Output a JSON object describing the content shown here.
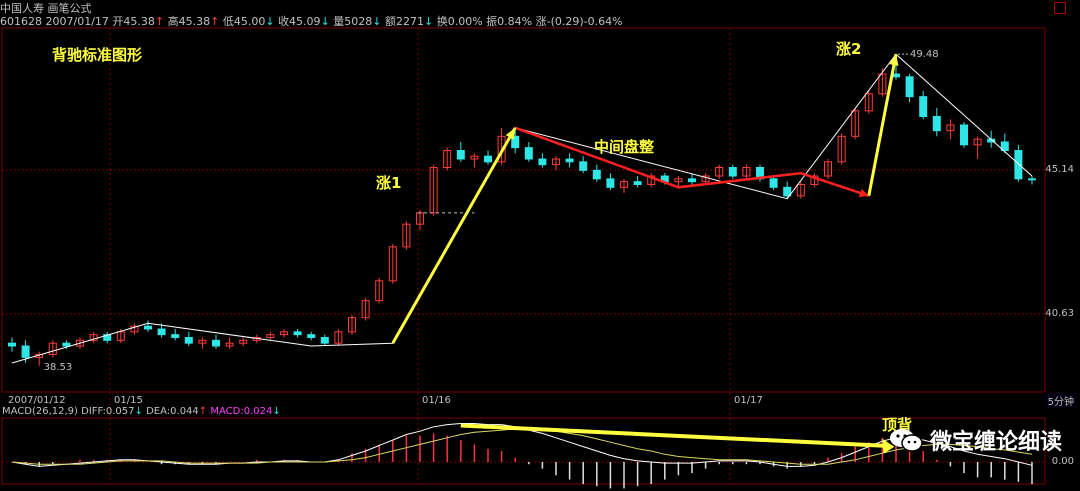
{
  "header": {
    "stock_name": "中国人寿",
    "tool": "画笔公式",
    "code": "601628",
    "date": "2007/01/17",
    "open_label": "开45.38",
    "high_label": "高45.38",
    "low_label": "低45.00",
    "close_label": "收45.09",
    "volume_label": "量5028",
    "amount_label": "额2271",
    "turnover_label": "换0.00%",
    "amplitude_label": "振0.84%",
    "change_label": "涨-(0.29)-0.64%"
  },
  "colors": {
    "up": "#ff3b3b",
    "down": "#2ee6e6",
    "pen_white": "#ffffff",
    "pen_red": "#ff2020",
    "annotation": "#ffff40",
    "grid": "#7a0000"
  },
  "annotations": {
    "title": "背驰标准图形",
    "rise1": "涨1",
    "consolidation": "中间盘整",
    "rise2": "涨2",
    "top_divergence": "顶背"
  },
  "price_labels": {
    "high_point": "49.48",
    "low_point": "38.53",
    "right_45": "45.14",
    "right_40": "40.63"
  },
  "x_labels": [
    "2007/01/12",
    "01/15",
    "01/16",
    "01/17"
  ],
  "timeframe": "5分钟",
  "macd_legend": {
    "name": "MACD(26,12,9)",
    "diff": "DIFF:0.057",
    "dea": "DEA:0.044",
    "macd": "MACD:0.024"
  },
  "macd_axis_label": "0.00",
  "watermark": "微宝缠论细读",
  "chart_data": {
    "type": "candlestick",
    "ylim": [
      38.0,
      50.0
    ],
    "candles": [
      [
        39.3,
        39.5,
        39.0,
        39.2
      ],
      [
        39.2,
        39.4,
        38.6,
        38.8
      ],
      [
        38.8,
        39.0,
        38.5,
        38.9
      ],
      [
        38.9,
        39.4,
        38.8,
        39.3
      ],
      [
        39.3,
        39.4,
        39.1,
        39.2
      ],
      [
        39.2,
        39.5,
        39.1,
        39.4
      ],
      [
        39.4,
        39.7,
        39.3,
        39.6
      ],
      [
        39.6,
        39.7,
        39.3,
        39.4
      ],
      [
        39.4,
        39.8,
        39.3,
        39.7
      ],
      [
        39.7,
        40.0,
        39.6,
        39.9
      ],
      [
        39.9,
        40.1,
        39.7,
        39.8
      ],
      [
        39.8,
        40.0,
        39.5,
        39.6
      ],
      [
        39.6,
        39.8,
        39.4,
        39.5
      ],
      [
        39.5,
        39.7,
        39.2,
        39.3
      ],
      [
        39.3,
        39.5,
        39.1,
        39.4
      ],
      [
        39.4,
        39.6,
        39.1,
        39.2
      ],
      [
        39.2,
        39.5,
        39.1,
        39.3
      ],
      [
        39.3,
        39.5,
        39.2,
        39.4
      ],
      [
        39.4,
        39.6,
        39.3,
        39.5
      ],
      [
        39.5,
        39.7,
        39.4,
        39.6
      ],
      [
        39.6,
        39.8,
        39.5,
        39.7
      ],
      [
        39.7,
        39.8,
        39.5,
        39.6
      ],
      [
        39.6,
        39.7,
        39.4,
        39.5
      ],
      [
        39.5,
        39.6,
        39.2,
        39.3
      ],
      [
        39.3,
        39.8,
        39.2,
        39.7
      ],
      [
        39.7,
        40.3,
        39.6,
        40.2
      ],
      [
        40.2,
        40.9,
        40.1,
        40.8
      ],
      [
        40.8,
        41.6,
        40.7,
        41.5
      ],
      [
        41.5,
        42.8,
        41.4,
        42.7
      ],
      [
        42.7,
        43.6,
        42.6,
        43.5
      ],
      [
        43.5,
        44.0,
        43.3,
        43.9
      ],
      [
        43.9,
        45.6,
        43.8,
        45.5
      ],
      [
        45.5,
        46.2,
        45.4,
        46.1
      ],
      [
        46.1,
        46.4,
        45.7,
        45.8
      ],
      [
        45.8,
        46.0,
        45.5,
        45.9
      ],
      [
        45.9,
        46.1,
        45.6,
        45.7
      ],
      [
        45.7,
        46.9,
        45.6,
        46.6
      ],
      [
        46.6,
        46.8,
        46.0,
        46.2
      ],
      [
        46.2,
        46.4,
        45.7,
        45.8
      ],
      [
        45.8,
        46.0,
        45.5,
        45.6
      ],
      [
        45.6,
        45.9,
        45.4,
        45.8
      ],
      [
        45.8,
        46.0,
        45.5,
        45.7
      ],
      [
        45.7,
        45.9,
        45.3,
        45.4
      ],
      [
        45.4,
        45.6,
        45.0,
        45.1
      ],
      [
        45.1,
        45.3,
        44.7,
        44.8
      ],
      [
        44.8,
        45.1,
        44.6,
        45.0
      ],
      [
        45.0,
        45.2,
        44.8,
        44.9
      ],
      [
        44.9,
        45.3,
        44.8,
        45.2
      ],
      [
        45.2,
        45.3,
        44.9,
        45.0
      ],
      [
        45.0,
        45.2,
        44.8,
        45.1
      ],
      [
        45.1,
        45.3,
        44.9,
        45.0
      ],
      [
        45.0,
        45.3,
        44.9,
        45.2
      ],
      [
        45.2,
        45.6,
        45.1,
        45.5
      ],
      [
        45.5,
        45.6,
        45.1,
        45.2
      ],
      [
        45.2,
        45.6,
        45.1,
        45.5
      ],
      [
        45.5,
        45.6,
        45.0,
        45.1
      ],
      [
        45.1,
        45.2,
        44.7,
        44.8
      ],
      [
        44.8,
        45.0,
        44.4,
        44.5
      ],
      [
        44.5,
        45.0,
        44.4,
        44.9
      ],
      [
        44.9,
        45.3,
        44.8,
        45.2
      ],
      [
        45.2,
        45.8,
        45.1,
        45.7
      ],
      [
        45.7,
        46.7,
        45.6,
        46.6
      ],
      [
        46.6,
        47.6,
        46.5,
        47.5
      ],
      [
        47.5,
        48.2,
        47.4,
        48.1
      ],
      [
        48.1,
        49.0,
        48.0,
        48.8
      ],
      [
        48.8,
        49.5,
        48.6,
        48.7
      ],
      [
        48.7,
        48.8,
        47.8,
        48.0
      ],
      [
        48.0,
        48.2,
        47.2,
        47.3
      ],
      [
        47.3,
        47.6,
        46.6,
        46.8
      ],
      [
        46.8,
        47.2,
        46.5,
        47.0
      ],
      [
        47.0,
        47.1,
        46.2,
        46.3
      ],
      [
        46.3,
        46.6,
        45.8,
        46.5
      ],
      [
        46.5,
        46.8,
        46.2,
        46.4
      ],
      [
        46.4,
        46.7,
        46.0,
        46.1
      ],
      [
        46.1,
        46.3,
        45.0,
        45.1
      ],
      [
        45.1,
        45.2,
        44.9,
        45.09
      ]
    ],
    "pen_white": [
      [
        0,
        38.6
      ],
      [
        10,
        40.0
      ],
      [
        22,
        39.2
      ],
      [
        28,
        39.3
      ],
      [
        37,
        46.9
      ],
      [
        57,
        44.4
      ],
      [
        65,
        49.5
      ],
      [
        75,
        45.2
      ]
    ],
    "pen_red": [
      [
        37,
        46.9
      ],
      [
        49,
        44.8
      ],
      [
        58,
        45.3
      ],
      [
        63,
        44.5
      ]
    ],
    "macd_diff": [
      0,
      -0.02,
      -0.04,
      -0.03,
      -0.02,
      -0.01,
      0,
      0.01,
      0.02,
      0.02,
      0.01,
      0,
      -0.01,
      -0.02,
      -0.02,
      -0.02,
      -0.01,
      -0.01,
      0,
      0,
      0.01,
      0.01,
      0,
      0,
      0.02,
      0.06,
      0.1,
      0.15,
      0.2,
      0.25,
      0.28,
      0.32,
      0.34,
      0.35,
      0.35,
      0.34,
      0.34,
      0.32,
      0.29,
      0.26,
      0.22,
      0.18,
      0.14,
      0.1,
      0.06,
      0.03,
      0.01,
      0,
      -0.01,
      -0.01,
      -0.01,
      0,
      0.01,
      0.01,
      0.01,
      0,
      -0.02,
      -0.04,
      -0.04,
      -0.03,
      0,
      0.04,
      0.09,
      0.14,
      0.19,
      0.22,
      0.22,
      0.2,
      0.17,
      0.14,
      0.1,
      0.07,
      0.05,
      0.03,
      0,
      -0.03
    ],
    "macd_dea": [
      0,
      -0.01,
      -0.02,
      -0.02,
      -0.02,
      -0.02,
      -0.01,
      0,
      0.01,
      0.01,
      0.01,
      0.01,
      0,
      -0.01,
      -0.01,
      -0.01,
      -0.01,
      -0.01,
      -0.01,
      0,
      0,
      0,
      0,
      0,
      0.01,
      0.02,
      0.04,
      0.07,
      0.1,
      0.13,
      0.16,
      0.19,
      0.22,
      0.25,
      0.27,
      0.28,
      0.29,
      0.3,
      0.3,
      0.29,
      0.28,
      0.26,
      0.24,
      0.21,
      0.18,
      0.15,
      0.12,
      0.1,
      0.07,
      0.05,
      0.04,
      0.03,
      0.02,
      0.02,
      0.02,
      0.01,
      0,
      -0.01,
      -0.02,
      -0.02,
      -0.02,
      0,
      0.02,
      0.05,
      0.08,
      0.11,
      0.13,
      0.15,
      0.16,
      0.16,
      0.15,
      0.14,
      0.12,
      0.11,
      0.09,
      0.07
    ]
  }
}
